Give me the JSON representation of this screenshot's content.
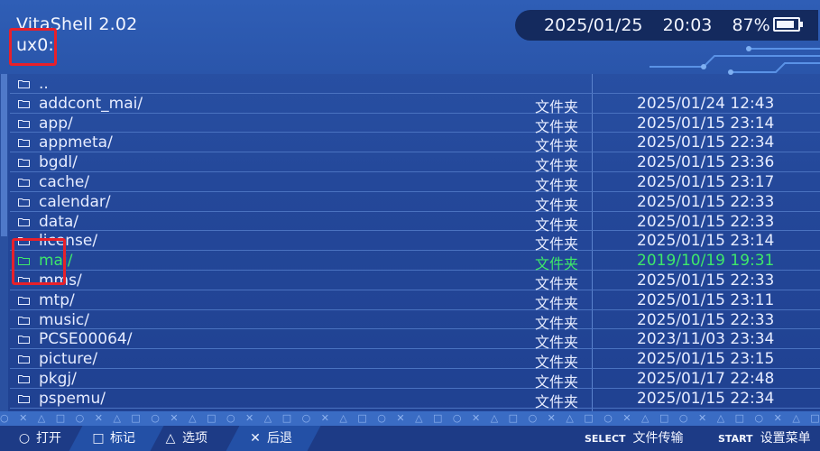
{
  "header": {
    "app_title": "VitaShell 2.02",
    "path": "ux0:",
    "date": "2025/01/25",
    "time": "20:03",
    "battery_percent": "87%",
    "battery_level": 0.87
  },
  "list": {
    "rows": [
      {
        "name": "..",
        "type": "",
        "date": ""
      },
      {
        "name": "addcont_mai/",
        "type": "文件夹",
        "date": "2025/01/24 12:43"
      },
      {
        "name": "app/",
        "type": "文件夹",
        "date": "2025/01/15 23:14"
      },
      {
        "name": "appmeta/",
        "type": "文件夹",
        "date": "2025/01/15 22:34"
      },
      {
        "name": "bgdl/",
        "type": "文件夹",
        "date": "2025/01/15 23:36"
      },
      {
        "name": "cache/",
        "type": "文件夹",
        "date": "2025/01/15 23:17"
      },
      {
        "name": "calendar/",
        "type": "文件夹",
        "date": "2025/01/15 22:33"
      },
      {
        "name": "data/",
        "type": "文件夹",
        "date": "2025/01/15 22:33"
      },
      {
        "name": "license/",
        "type": "文件夹",
        "date": "2025/01/15 23:14"
      },
      {
        "name": "mai/",
        "type": "文件夹",
        "date": "2019/10/19 19:31",
        "selected": true
      },
      {
        "name": "mms/",
        "type": "文件夹",
        "date": "2025/01/15 22:33"
      },
      {
        "name": "mtp/",
        "type": "文件夹",
        "date": "2025/01/15 23:11"
      },
      {
        "name": "music/",
        "type": "文件夹",
        "date": "2025/01/15 22:33"
      },
      {
        "name": "PCSE00064/",
        "type": "文件夹",
        "date": "2023/11/03 23:34"
      },
      {
        "name": "picture/",
        "type": "文件夹",
        "date": "2025/01/15 23:15"
      },
      {
        "name": "pkgj/",
        "type": "文件夹",
        "date": "2025/01/17 22:48"
      },
      {
        "name": "pspemu/",
        "type": "文件夹",
        "date": "2025/01/15 22:34"
      }
    ]
  },
  "footer": {
    "open": {
      "glyph": "○",
      "label": "打开"
    },
    "mark": {
      "glyph": "□",
      "label": "标记"
    },
    "options": {
      "glyph": "△",
      "label": "选项"
    },
    "back": {
      "glyph": "✕",
      "label": "后退"
    },
    "select": {
      "key": "SELECT",
      "label": "文件传输"
    },
    "start": {
      "key": "START",
      "label": "设置菜单"
    }
  },
  "colors": {
    "background": "#24489a",
    "text": "#e6ecff",
    "selected_text": "#3ee86a",
    "highlight_box": "#e8202a"
  }
}
